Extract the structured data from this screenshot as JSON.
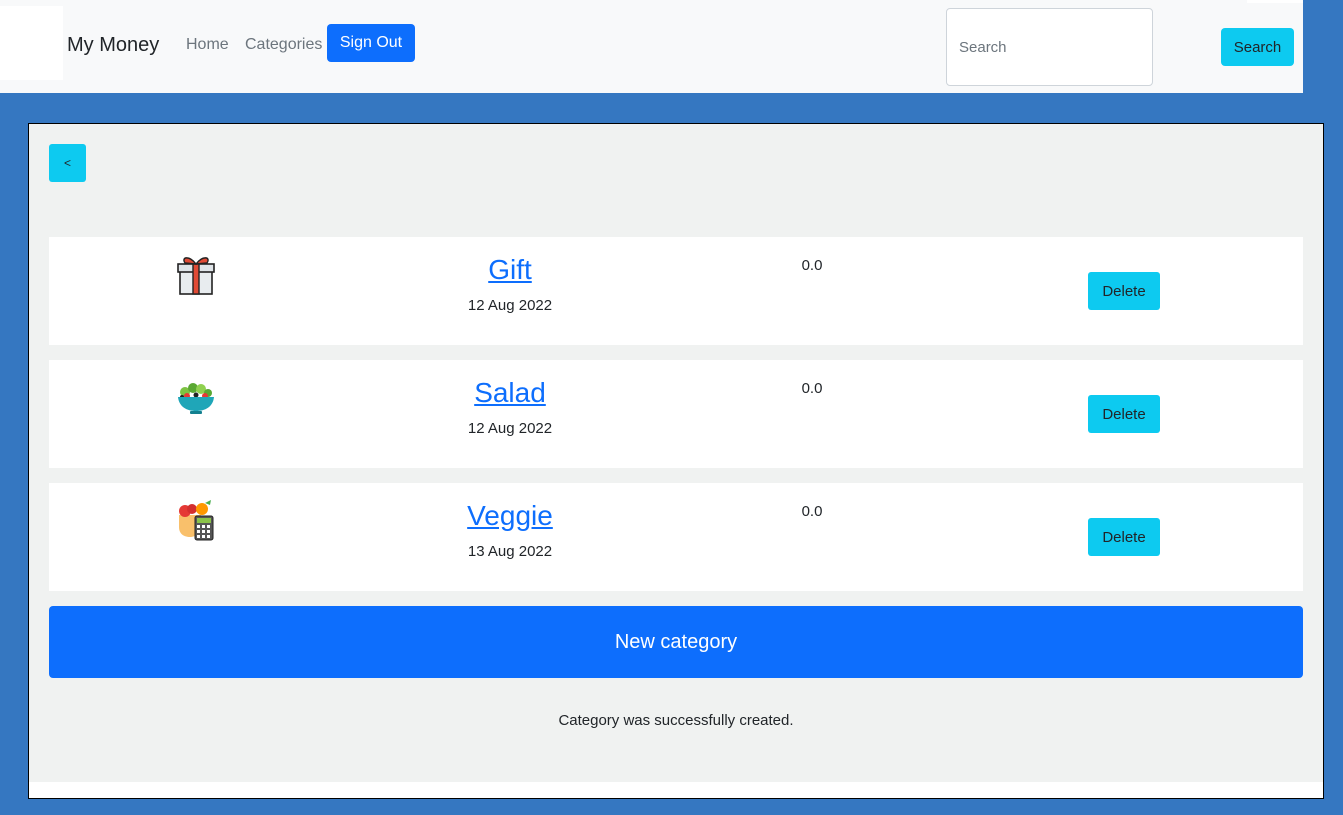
{
  "navbar": {
    "brand": "My Money",
    "links": [
      "Home",
      "Categories"
    ],
    "sign_out_label": "Sign Out",
    "search_placeholder": "Search",
    "search_button_label": "Search"
  },
  "page": {
    "back_label": "<",
    "categories": [
      {
        "name": "Gift",
        "date": "12 Aug 2022",
        "amount": "0.0",
        "icon": "gift-icon",
        "delete_label": "Delete"
      },
      {
        "name": "Salad",
        "date": "12 Aug 2022",
        "amount": "0.0",
        "icon": "salad-icon",
        "delete_label": "Delete"
      },
      {
        "name": "Veggie",
        "date": "13 Aug 2022",
        "amount": "0.0",
        "icon": "veggie-calculator-icon",
        "delete_label": "Delete"
      }
    ],
    "new_category_label": "New category",
    "notice": "Category was successfully created."
  },
  "colors": {
    "background": "#3577c1",
    "primary": "#0d6efd",
    "info": "#0dcaf0"
  }
}
